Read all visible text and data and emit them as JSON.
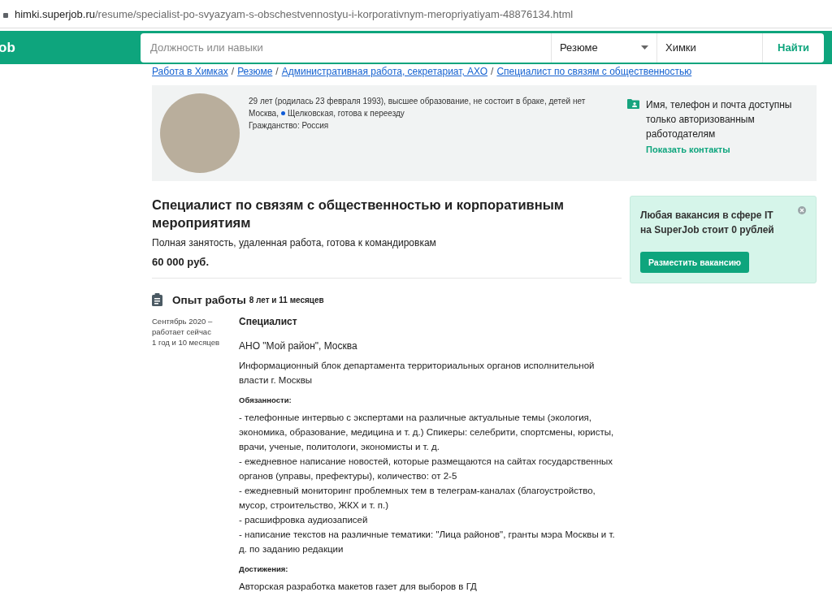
{
  "address_bar": {
    "domain": "himki.superjob.ru",
    "path": "/resume/specialist-po-svyazyam-s-obschestvennostyu-i-korporativnym-meropriyatiyam-48876134.html"
  },
  "header": {
    "logo": "ob",
    "search": {
      "placeholder": "Должность или навыки"
    },
    "type_select": "Резюме",
    "city": "Химки",
    "search_button": "Найти"
  },
  "breadcrumb_separator": "/",
  "breadcrumbs": [
    "Работа в Химках",
    "Резюме",
    "Административная работа, секретариат, АХО",
    "Специалист по связям с общественностью"
  ],
  "profile": {
    "details": "29 лет (родилась 23 февраля 1993), высшее образование, не состоит в браке, детей нет",
    "city": "Москва,",
    "metro": {
      "name": "Щелковская, готова к переезду",
      "color": "#0f5bd6"
    },
    "citizenship": "Гражданство: Россия",
    "contacts_note": "Имя, телефон и почта доступны только авторизованным работодателям",
    "contacts_link": "Показать контакты"
  },
  "resume": {
    "title": "Специалист по связям с общественностью и корпоративным мероприятиям",
    "employment": "Полная занятость, удаленная работа, готова к командировкам",
    "salary": "60 000 руб."
  },
  "promo": {
    "text": "Любая вакансия в сфере IT на SuperJob стоит 0 рублей",
    "button": "Разместить вакансию"
  },
  "experience": {
    "heading": "Опыт работы",
    "total": "8 лет и 11 месяцев",
    "jobs": [
      {
        "period": "Сентябрь 2020 – работает сейчас",
        "duration": "1 год и 10 месяцев",
        "position": "Специалист",
        "company": "АНО \"Мой район\", Москва",
        "department": "Информационный блок департамента территориальных органов исполнительной власти г. Москвы",
        "duties_label": "Обязанности:",
        "duties": [
          "- телефонные интервью с экспертами на различные актуальные темы (экология, экономика, образование, медицина и т. д.) Спикеры: селебрити, спортсмены, юристы, врачи, ученые, политологи, экономисты и т. д.",
          "- ежедневное написание новостей, которые размещаются на сайтах государственных органов (управы, префектуры), количество: от 2-5",
          "- ежедневный мониторинг проблемных тем в телеграм-каналах (благоустройство, мусор, строительство, ЖКХ и т. п.)",
          "- расшифровка аудиозаписей",
          "- написание текстов на различные тематики: \"Лица районов\", гранты мэра Москвы и т. д. по заданию редакции"
        ],
        "achievements_label": "Достижения:",
        "achievements": "Авторская разработка макетов газет для выборов в ГД"
      }
    ]
  }
}
